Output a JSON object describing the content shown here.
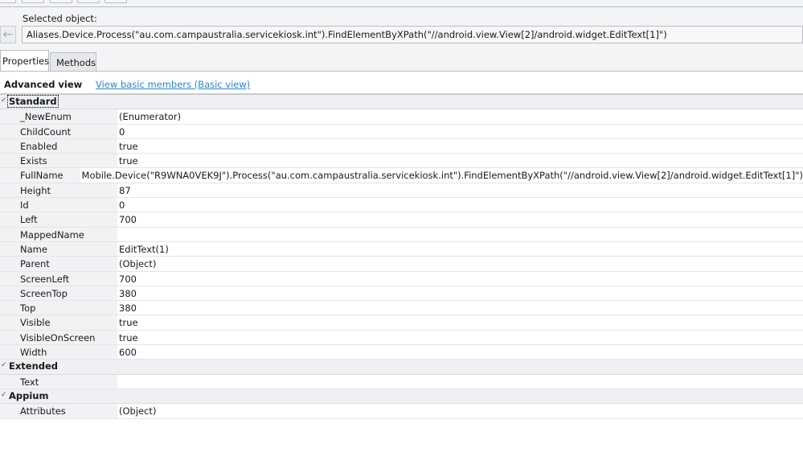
{
  "selected_object_label": "Selected object:",
  "selected_object_path": "Aliases.Device.Process(\"au.com.campaustralia.servicekiosk.int\").FindElementByXPath(\"//android.view.View[2]/android.widget.EditText[1]\")",
  "tabs": [
    {
      "label": "Properties",
      "active": true
    },
    {
      "label": "Methods",
      "active": false
    }
  ],
  "view": {
    "title": "Advanced view",
    "link": "View basic members (Basic view)"
  },
  "groups": [
    {
      "name": "Standard",
      "properties": [
        {
          "name": "_NewEnum",
          "value": "(Enumerator)"
        },
        {
          "name": "ChildCount",
          "value": "0"
        },
        {
          "name": "Enabled",
          "value": "true"
        },
        {
          "name": "Exists",
          "value": "true"
        },
        {
          "name": "FullName",
          "value": "Mobile.Device(\"R9WNA0VEK9J\").Process(\"au.com.campaustralia.servicekiosk.int\").FindElementByXPath(\"//android.view.View[2]/android.widget.EditText[1]\")"
        },
        {
          "name": "Height",
          "value": "87"
        },
        {
          "name": "Id",
          "value": "0"
        },
        {
          "name": "Left",
          "value": "700"
        },
        {
          "name": "MappedName",
          "value": ""
        },
        {
          "name": "Name",
          "value": "EditText(1)"
        },
        {
          "name": "Parent",
          "value": "(Object)"
        },
        {
          "name": "ScreenLeft",
          "value": "700"
        },
        {
          "name": "ScreenTop",
          "value": "380"
        },
        {
          "name": "Top",
          "value": "380"
        },
        {
          "name": "Visible",
          "value": "true"
        },
        {
          "name": "VisibleOnScreen",
          "value": "true"
        },
        {
          "name": "Width",
          "value": "600"
        }
      ]
    },
    {
      "name": "Extended",
      "properties": [
        {
          "name": "Text",
          "value": ""
        }
      ]
    },
    {
      "name": "Appium",
      "properties": [
        {
          "name": "Attributes",
          "value": "(Object)"
        }
      ]
    }
  ]
}
